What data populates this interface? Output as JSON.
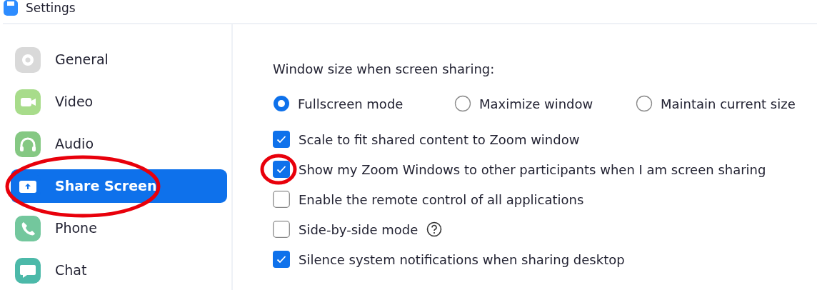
{
  "window": {
    "title": "Settings"
  },
  "sidebar": {
    "items": [
      {
        "label": "General",
        "kind": "gear",
        "selected": false,
        "highlighted": false
      },
      {
        "label": "Video",
        "kind": "video",
        "selected": false,
        "highlighted": false
      },
      {
        "label": "Audio",
        "kind": "audio",
        "selected": false,
        "highlighted": false
      },
      {
        "label": "Share Screen",
        "kind": "share",
        "selected": true,
        "highlighted": true
      },
      {
        "label": "Phone",
        "kind": "phone",
        "selected": false,
        "highlighted": false
      },
      {
        "label": "Chat",
        "kind": "chat",
        "selected": false,
        "highlighted": false
      }
    ]
  },
  "content": {
    "window_size_label": "Window size when screen sharing:",
    "window_size_options": [
      {
        "label": "Fullscreen mode",
        "selected": true
      },
      {
        "label": "Maximize window",
        "selected": false
      },
      {
        "label": "Maintain current size",
        "selected": false
      }
    ],
    "options": [
      {
        "label": "Scale to fit shared content to Zoom window",
        "checked": true,
        "highlighted": false,
        "help": false
      },
      {
        "label": "Show my Zoom Windows to other participants when I am screen sharing",
        "checked": true,
        "highlighted": true,
        "help": false
      },
      {
        "label": "Enable the remote control of all applications",
        "checked": false,
        "highlighted": false,
        "help": false
      },
      {
        "label": "Side-by-side mode",
        "checked": false,
        "highlighted": false,
        "help": true
      },
      {
        "label": "Silence system notifications when sharing desktop",
        "checked": true,
        "highlighted": false,
        "help": false
      }
    ]
  }
}
